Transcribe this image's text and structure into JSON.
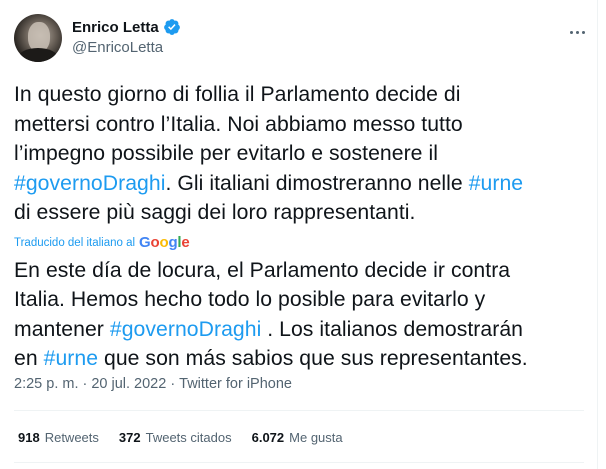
{
  "author": {
    "display_name": "Enrico Letta",
    "handle": "@EnricoLetta",
    "verified_color": "#1d9bf0"
  },
  "tweet": {
    "original_lines": [
      [
        {
          "t": "In questo giorno di follia il Parlamento decide di",
          "tag": false
        }
      ],
      [
        {
          "t": "mettersi contro l’Italia. Noi abbiamo messo tutto",
          "tag": false
        }
      ],
      [
        {
          "t": "l’impegno possibile per evitarlo e sostenere il",
          "tag": false
        }
      ],
      [
        {
          "t": "#governoDraghi",
          "tag": true
        },
        {
          "t": ". Gli italiani dimostreranno nelle ",
          "tag": false
        },
        {
          "t": "#urne",
          "tag": true
        }
      ],
      [
        {
          "t": "di essere più saggi dei loro rappresentanti.",
          "tag": false
        }
      ]
    ],
    "translated_label": "Traducido del italiano al",
    "google_logo": [
      "G",
      "o",
      "o",
      "g",
      "l",
      "e"
    ],
    "translation_lines": [
      [
        {
          "t": "En este día de locura, el Parlamento decide ir contra",
          "tag": false
        }
      ],
      [
        {
          "t": "Italia. Hemos hecho todo lo posible para evitarlo y",
          "tag": false
        }
      ],
      [
        {
          "t": "mantener ",
          "tag": false
        },
        {
          "t": "#governoDraghi",
          "tag": true
        },
        {
          "t": " . Los italianos demostrarán",
          "tag": false
        }
      ],
      [
        {
          "t": "en ",
          "tag": false
        },
        {
          "t": "#urne",
          "tag": true
        },
        {
          "t": " que son más sabios que sus representantes.",
          "tag": false
        }
      ]
    ]
  },
  "meta": {
    "time": "2:25 p. m.",
    "separator": "·",
    "date": "20 jul. 2022",
    "source": "Twitter for iPhone"
  },
  "stats": {
    "retweets_count": "918",
    "retweets_label": "Retweets",
    "quotes_count": "372",
    "quotes_label": "Tweets citados",
    "likes_count": "6.072",
    "likes_label": "Me gusta"
  },
  "colors": {
    "link": "#1d9bf0",
    "text": "#0f1419",
    "secondary": "#536471"
  },
  "icons": {
    "verified": "verified-badge-icon",
    "more": "more-options-icon"
  }
}
